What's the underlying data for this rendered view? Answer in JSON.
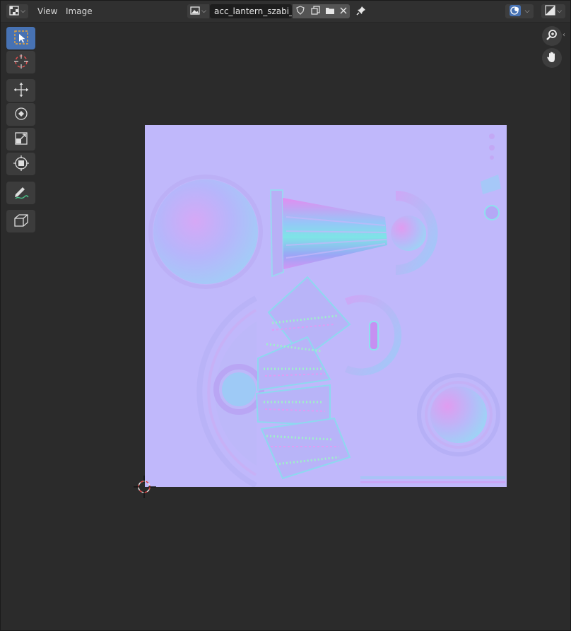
{
  "header": {
    "editor_type_icon": "image-editor-icon",
    "menus": [
      {
        "label": "View"
      },
      {
        "label": "Image"
      }
    ],
    "image_browse_icon": "image-browse-icon",
    "image_name": "acc_lantern_szabi_N...",
    "fake_user_icon": "shield-icon",
    "new_image_icon": "duplicate-icon",
    "open_image_icon": "folder-icon",
    "unlink_icon": "close-icon",
    "pin_icon": "pin-icon",
    "overlays_icon": "overlays-icon",
    "display_channels_icon": "display-channels-icon"
  },
  "toolbar": {
    "tools": [
      {
        "name": "select-box",
        "icon": "select-box-icon",
        "active": true
      },
      {
        "name": "cursor",
        "icon": "cursor-icon",
        "active": false
      },
      {
        "name": "move",
        "icon": "move-icon",
        "active": false
      },
      {
        "name": "rotate",
        "icon": "rotate-icon",
        "active": false
      },
      {
        "name": "scale",
        "icon": "scale-icon",
        "active": false
      },
      {
        "name": "transform",
        "icon": "transform-icon",
        "active": false
      },
      {
        "name": "annotate",
        "icon": "annotate-icon",
        "active": false
      },
      {
        "name": "sample",
        "icon": "sample-icon",
        "active": false
      }
    ]
  },
  "navigation": {
    "zoom_icon": "zoom-icon",
    "pan_icon": "hand-icon"
  },
  "colors": {
    "header_bg": "#303030",
    "canvas_bg": "#2b2b2b",
    "active_tool": "#4772b3",
    "normal_map_base": "#c0b8fb"
  }
}
